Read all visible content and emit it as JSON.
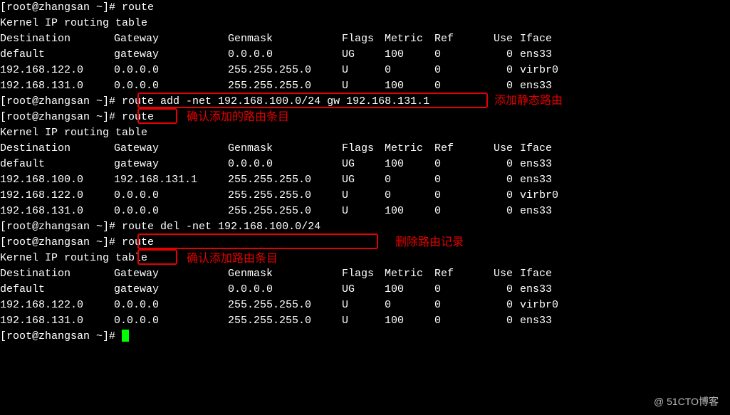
{
  "prompt": "[root@zhangsan ~]# ",
  "cmd_route": "route",
  "cmd_add": "route add -net 192.168.100.0/24 gw 192.168.131.1",
  "cmd_del": "route del -net 192.168.100.0/24",
  "table_title": "Kernel IP routing table",
  "hdr": {
    "dest": "Destination",
    "gw": "Gateway",
    "mask": "Genmask",
    "flags": "Flags",
    "metric": "Metric",
    "ref": "Ref",
    "use": "Use",
    "iface": "Iface"
  },
  "table1": [
    {
      "dest": "default",
      "gw": "gateway",
      "mask": "0.0.0.0",
      "flags": "UG",
      "metric": "100",
      "ref": "0",
      "use": "0",
      "iface": "ens33"
    },
    {
      "dest": "192.168.122.0",
      "gw": "0.0.0.0",
      "mask": "255.255.255.0",
      "flags": "U",
      "metric": "0",
      "ref": "0",
      "use": "0",
      "iface": "virbr0"
    },
    {
      "dest": "192.168.131.0",
      "gw": "0.0.0.0",
      "mask": "255.255.255.0",
      "flags": "U",
      "metric": "100",
      "ref": "0",
      "use": "0",
      "iface": "ens33"
    }
  ],
  "table2": [
    {
      "dest": "default",
      "gw": "gateway",
      "mask": "0.0.0.0",
      "flags": "UG",
      "metric": "100",
      "ref": "0",
      "use": "0",
      "iface": "ens33"
    },
    {
      "dest": "192.168.100.0",
      "gw": "192.168.131.1",
      "mask": "255.255.255.0",
      "flags": "UG",
      "metric": "0",
      "ref": "0",
      "use": "0",
      "iface": "ens33"
    },
    {
      "dest": "192.168.122.0",
      "gw": "0.0.0.0",
      "mask": "255.255.255.0",
      "flags": "U",
      "metric": "0",
      "ref": "0",
      "use": "0",
      "iface": "virbr0"
    },
    {
      "dest": "192.168.131.0",
      "gw": "0.0.0.0",
      "mask": "255.255.255.0",
      "flags": "U",
      "metric": "100",
      "ref": "0",
      "use": "0",
      "iface": "ens33"
    }
  ],
  "table3": [
    {
      "dest": "default",
      "gw": "gateway",
      "mask": "0.0.0.0",
      "flags": "UG",
      "metric": "100",
      "ref": "0",
      "use": "0",
      "iface": "ens33"
    },
    {
      "dest": "192.168.122.0",
      "gw": "0.0.0.0",
      "mask": "255.255.255.0",
      "flags": "U",
      "metric": "0",
      "ref": "0",
      "use": "0",
      "iface": "virbr0"
    },
    {
      "dest": "192.168.131.0",
      "gw": "0.0.0.0",
      "mask": "255.255.255.0",
      "flags": "U",
      "metric": "100",
      "ref": "0",
      "use": "0",
      "iface": "ens33"
    }
  ],
  "ann": {
    "add_static": "添加静态路由",
    "confirm_added": "确认添加的路由条目",
    "del_record": "删除路由记录",
    "confirm_add2": "确认添加路由条目"
  },
  "watermark": "@ 51CTO博客"
}
